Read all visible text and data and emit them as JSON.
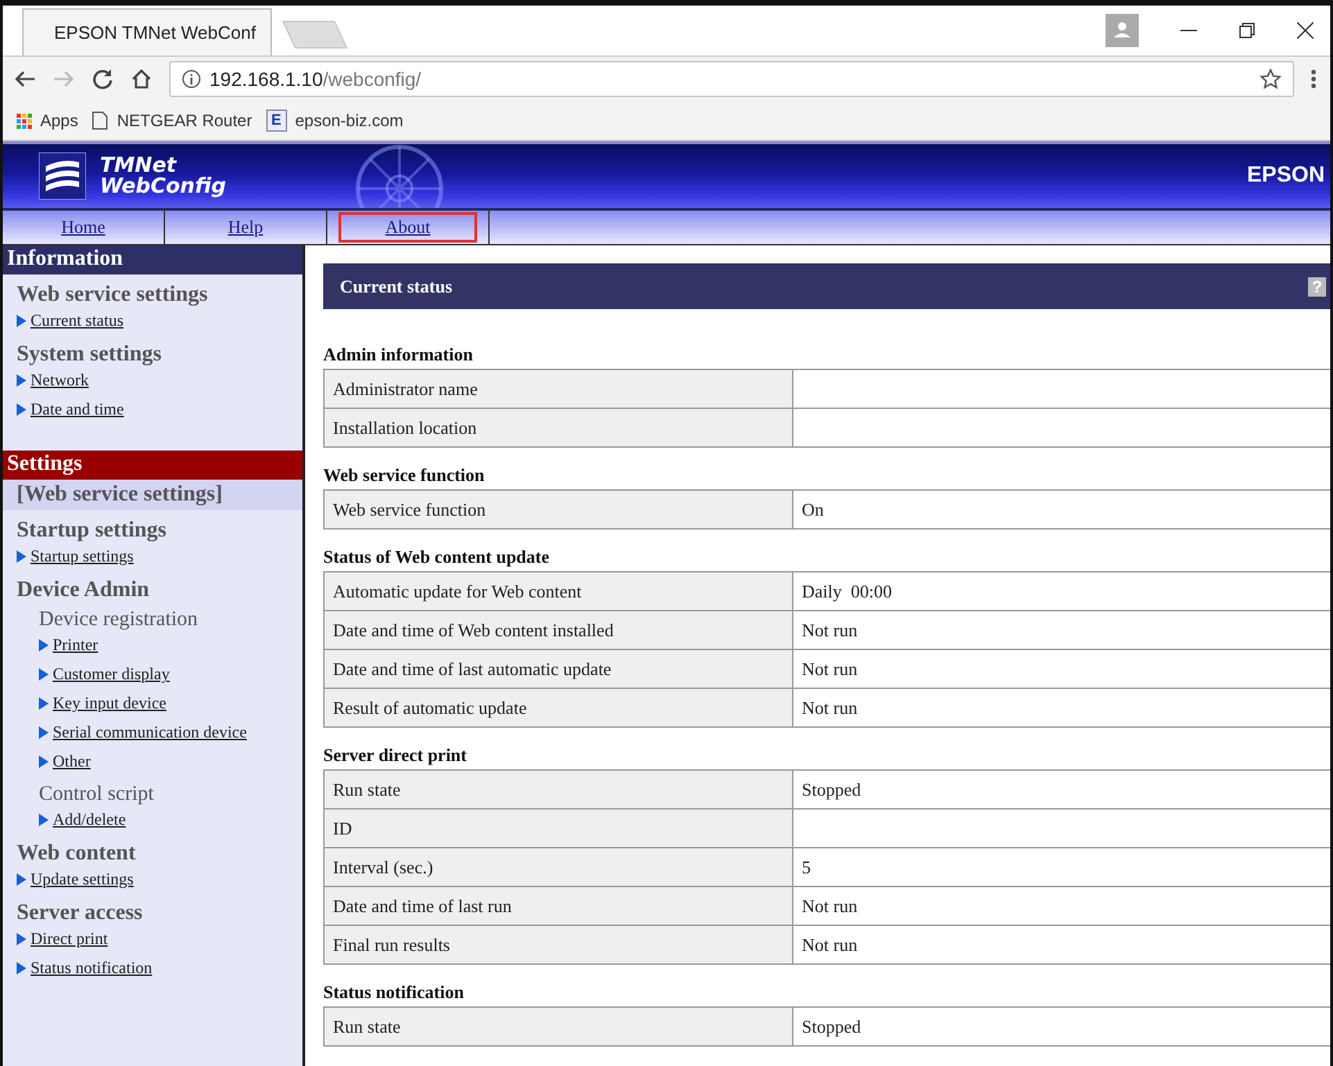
{
  "browser": {
    "tab_title": "EPSON TMNet WebConf",
    "address_host": "192.168.1.10",
    "address_path": "/webconfig/",
    "bookmarks": [
      {
        "kind": "apps",
        "text": "Apps"
      },
      {
        "kind": "page",
        "text": "NETGEAR Router"
      },
      {
        "kind": "letter",
        "icon": "E",
        "text": "epson-biz.com"
      }
    ]
  },
  "banner": {
    "title_line_1": "TMNet",
    "title_line_2": "WebConfig",
    "brand": "EPSON"
  },
  "nav": [
    {
      "label": "Home",
      "selected": false
    },
    {
      "label": "Help",
      "selected": false
    },
    {
      "label": "About",
      "selected": true
    }
  ],
  "sidebar": {
    "sections": [
      {
        "title": "Information",
        "color": "#2e2f66",
        "items": [
          {
            "kind": "heading",
            "text": "Web service settings"
          },
          {
            "kind": "link",
            "text": "Current status"
          },
          {
            "kind": "heading",
            "text": "System settings"
          },
          {
            "kind": "link",
            "text": "Network"
          },
          {
            "kind": "link",
            "text": "Date and time"
          }
        ]
      },
      {
        "title": "Settings",
        "color": "#990000",
        "items": [
          {
            "kind": "current",
            "text": "[Web service settings]"
          },
          {
            "kind": "heading",
            "text": "Startup settings"
          },
          {
            "kind": "link",
            "text": "Startup settings"
          },
          {
            "kind": "heading",
            "text": "Device Admin"
          },
          {
            "kind": "subheading",
            "text": "Device registration"
          },
          {
            "kind": "sublink",
            "text": "Printer"
          },
          {
            "kind": "sublink",
            "text": "Customer display"
          },
          {
            "kind": "sublink",
            "text": "Key input device"
          },
          {
            "kind": "sublink",
            "text": "Serial communication device"
          },
          {
            "kind": "sublink",
            "text": "Other"
          },
          {
            "kind": "subheading",
            "text": "Control script"
          },
          {
            "kind": "sublink",
            "text": "Add/delete"
          },
          {
            "kind": "heading",
            "text": "Web content"
          },
          {
            "kind": "link",
            "text": "Update settings"
          },
          {
            "kind": "heading",
            "text": "Server access"
          },
          {
            "kind": "link",
            "text": "Direct print"
          },
          {
            "kind": "link",
            "text": "Status notification"
          }
        ]
      }
    ]
  },
  "panel": {
    "title": "Current status",
    "help": "?"
  },
  "sections": [
    {
      "title": "Admin information",
      "rows": [
        {
          "label": "Administrator name"
        },
        {
          "label": "Installation location"
        }
      ]
    },
    {
      "title": "Web service function",
      "rows": [
        {
          "label": "Web service function",
          "value": "On"
        }
      ]
    },
    {
      "title": "Status of Web content update",
      "rows": [
        {
          "label": "Automatic update for Web content",
          "value": "Daily  00:00"
        },
        {
          "label": "Date and time of Web content installed",
          "value": "Not run"
        },
        {
          "label": "Date and time of last automatic update",
          "value": "Not run"
        },
        {
          "label": "Result of automatic update",
          "value": "Not run"
        }
      ]
    },
    {
      "title": "Server direct print",
      "rows": [
        {
          "label": "Run state",
          "value": "Stopped"
        },
        {
          "label": "ID"
        },
        {
          "label": "Interval (sec.)",
          "value": "5"
        },
        {
          "label": "Date and time of last run",
          "value": "Not run"
        },
        {
          "label": "Final run results",
          "value": "Not run"
        }
      ]
    },
    {
      "title": "Status notification",
      "rows": [
        {
          "label": "Run state",
          "value": "Stopped"
        }
      ]
    }
  ]
}
